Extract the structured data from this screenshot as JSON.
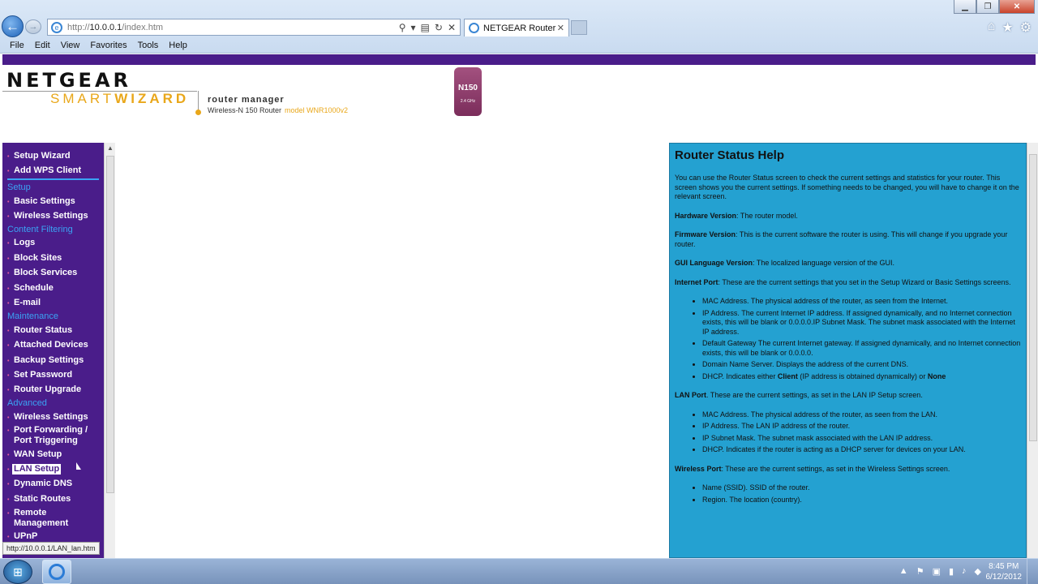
{
  "browser": {
    "url_prefix": "http://",
    "url_host": "10.0.0.1",
    "url_path": "/index.htm",
    "tab_title": "NETGEAR Router",
    "menu": [
      "File",
      "Edit",
      "View",
      "Favorites",
      "Tools",
      "Help"
    ],
    "status_url": "http://10.0.0.1/LAN_lan.htm"
  },
  "header": {
    "brand": "NETGEAR",
    "brand_sub_a": "SMART",
    "brand_sub_b": "WIZARD",
    "title": "router manager",
    "subtitle": "Wireless-N 150 Router",
    "model": "model WNR1000v2",
    "badge_main": "N150",
    "badge_sub": "2.4 GHz"
  },
  "sidebar": {
    "top_items": [
      "Setup Wizard",
      "Add WPS Client"
    ],
    "sections": [
      {
        "title": "Setup",
        "items": [
          "Basic Settings",
          "Wireless Settings"
        ]
      },
      {
        "title": "Content Filtering",
        "items": [
          "Logs",
          "Block Sites",
          "Block Services",
          "Schedule",
          "E-mail"
        ]
      },
      {
        "title": "Maintenance",
        "items": [
          "Router Status",
          "Attached Devices",
          "Backup Settings",
          "Set Password",
          "Router Upgrade"
        ]
      },
      {
        "title": "Advanced",
        "items": [
          "Wireless Settings",
          "Port Forwarding / Port Triggering",
          "WAN Setup",
          "LAN Setup",
          "Dynamic DNS",
          "Static Routes",
          "Remote Management",
          "UPnP"
        ]
      }
    ]
  },
  "help": {
    "title": "Router Status Help",
    "intro": "You can use the Router Status screen to check the current settings and statistics for your router. This screen shows you the current settings. If something needs to be changed, you will have to change it on the relevant screen.",
    "hw_term": "Hardware Version",
    "hw_text": ": The router model.",
    "fw_term": "Firmware Version",
    "fw_text": ": This is the current software the router is using. This will change if you upgrade your router.",
    "gui_term": "GUI Language Version",
    "gui_text": ": The localized language version of the GUI.",
    "internet_term": "Internet Port",
    "internet_text": ": These are the current settings that you set in the Setup Wizard or Basic Settings screens.",
    "internet_items": [
      "MAC Address. The physical address of the router, as seen from the Internet.",
      "IP Address. The current Internet IP address. If assigned dynamically, and no Internet connection exists, this will be blank or 0.0.0.0.IP Subnet Mask. The subnet mask associated with the Internet IP address.",
      "Default Gateway The current Internet gateway. If assigned dynamically, and no Internet connection exists, this will be blank or 0.0.0.0.",
      "Domain Name Server. Displays the address of the current DNS."
    ],
    "dhcp_prefix": "DHCP. Indicates either ",
    "dhcp_client": "Client",
    "dhcp_mid": " (IP address is obtained dynamically) or ",
    "dhcp_none": "None",
    "lan_term": "LAN Port",
    "lan_text": ". These are the current settings, as set in the LAN IP Setup screen.",
    "lan_items": [
      "MAC Address. The physical address of the router, as seen from the LAN.",
      "IP Address. The LAN IP address of the router.",
      "IP Subnet Mask. The subnet mask associated with the LAN IP address.",
      "DHCP. Indicates if the router is acting as a DHCP server for devices on your LAN."
    ],
    "wireless_term": "Wireless Port",
    "wireless_text": ": These are the current settings, as set in the Wireless Settings screen.",
    "wireless_items": [
      "Name (SSID). SSID of the router.",
      "Region. The location (country)."
    ]
  },
  "taskbar": {
    "time": "8:45 PM",
    "date": "6/12/2012"
  }
}
